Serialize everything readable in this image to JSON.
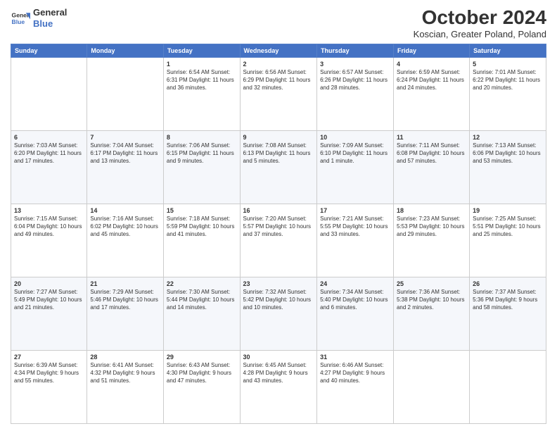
{
  "logo": {
    "line1": "General",
    "line2": "Blue"
  },
  "title": "October 2024",
  "subtitle": "Koscian, Greater Poland, Poland",
  "days_of_week": [
    "Sunday",
    "Monday",
    "Tuesday",
    "Wednesday",
    "Thursday",
    "Friday",
    "Saturday"
  ],
  "weeks": [
    [
      {
        "day": "",
        "info": ""
      },
      {
        "day": "",
        "info": ""
      },
      {
        "day": "1",
        "info": "Sunrise: 6:54 AM\nSunset: 6:31 PM\nDaylight: 11 hours\nand 36 minutes."
      },
      {
        "day": "2",
        "info": "Sunrise: 6:56 AM\nSunset: 6:29 PM\nDaylight: 11 hours\nand 32 minutes."
      },
      {
        "day": "3",
        "info": "Sunrise: 6:57 AM\nSunset: 6:26 PM\nDaylight: 11 hours\nand 28 minutes."
      },
      {
        "day": "4",
        "info": "Sunrise: 6:59 AM\nSunset: 6:24 PM\nDaylight: 11 hours\nand 24 minutes."
      },
      {
        "day": "5",
        "info": "Sunrise: 7:01 AM\nSunset: 6:22 PM\nDaylight: 11 hours\nand 20 minutes."
      }
    ],
    [
      {
        "day": "6",
        "info": "Sunrise: 7:03 AM\nSunset: 6:20 PM\nDaylight: 11 hours\nand 17 minutes."
      },
      {
        "day": "7",
        "info": "Sunrise: 7:04 AM\nSunset: 6:17 PM\nDaylight: 11 hours\nand 13 minutes."
      },
      {
        "day": "8",
        "info": "Sunrise: 7:06 AM\nSunset: 6:15 PM\nDaylight: 11 hours\nand 9 minutes."
      },
      {
        "day": "9",
        "info": "Sunrise: 7:08 AM\nSunset: 6:13 PM\nDaylight: 11 hours\nand 5 minutes."
      },
      {
        "day": "10",
        "info": "Sunrise: 7:09 AM\nSunset: 6:10 PM\nDaylight: 11 hours\nand 1 minute."
      },
      {
        "day": "11",
        "info": "Sunrise: 7:11 AM\nSunset: 6:08 PM\nDaylight: 10 hours\nand 57 minutes."
      },
      {
        "day": "12",
        "info": "Sunrise: 7:13 AM\nSunset: 6:06 PM\nDaylight: 10 hours\nand 53 minutes."
      }
    ],
    [
      {
        "day": "13",
        "info": "Sunrise: 7:15 AM\nSunset: 6:04 PM\nDaylight: 10 hours\nand 49 minutes."
      },
      {
        "day": "14",
        "info": "Sunrise: 7:16 AM\nSunset: 6:02 PM\nDaylight: 10 hours\nand 45 minutes."
      },
      {
        "day": "15",
        "info": "Sunrise: 7:18 AM\nSunset: 5:59 PM\nDaylight: 10 hours\nand 41 minutes."
      },
      {
        "day": "16",
        "info": "Sunrise: 7:20 AM\nSunset: 5:57 PM\nDaylight: 10 hours\nand 37 minutes."
      },
      {
        "day": "17",
        "info": "Sunrise: 7:21 AM\nSunset: 5:55 PM\nDaylight: 10 hours\nand 33 minutes."
      },
      {
        "day": "18",
        "info": "Sunrise: 7:23 AM\nSunset: 5:53 PM\nDaylight: 10 hours\nand 29 minutes."
      },
      {
        "day": "19",
        "info": "Sunrise: 7:25 AM\nSunset: 5:51 PM\nDaylight: 10 hours\nand 25 minutes."
      }
    ],
    [
      {
        "day": "20",
        "info": "Sunrise: 7:27 AM\nSunset: 5:49 PM\nDaylight: 10 hours\nand 21 minutes."
      },
      {
        "day": "21",
        "info": "Sunrise: 7:29 AM\nSunset: 5:46 PM\nDaylight: 10 hours\nand 17 minutes."
      },
      {
        "day": "22",
        "info": "Sunrise: 7:30 AM\nSunset: 5:44 PM\nDaylight: 10 hours\nand 14 minutes."
      },
      {
        "day": "23",
        "info": "Sunrise: 7:32 AM\nSunset: 5:42 PM\nDaylight: 10 hours\nand 10 minutes."
      },
      {
        "day": "24",
        "info": "Sunrise: 7:34 AM\nSunset: 5:40 PM\nDaylight: 10 hours\nand 6 minutes."
      },
      {
        "day": "25",
        "info": "Sunrise: 7:36 AM\nSunset: 5:38 PM\nDaylight: 10 hours\nand 2 minutes."
      },
      {
        "day": "26",
        "info": "Sunrise: 7:37 AM\nSunset: 5:36 PM\nDaylight: 9 hours\nand 58 minutes."
      }
    ],
    [
      {
        "day": "27",
        "info": "Sunrise: 6:39 AM\nSunset: 4:34 PM\nDaylight: 9 hours\nand 55 minutes."
      },
      {
        "day": "28",
        "info": "Sunrise: 6:41 AM\nSunset: 4:32 PM\nDaylight: 9 hours\nand 51 minutes."
      },
      {
        "day": "29",
        "info": "Sunrise: 6:43 AM\nSunset: 4:30 PM\nDaylight: 9 hours\nand 47 minutes."
      },
      {
        "day": "30",
        "info": "Sunrise: 6:45 AM\nSunset: 4:28 PM\nDaylight: 9 hours\nand 43 minutes."
      },
      {
        "day": "31",
        "info": "Sunrise: 6:46 AM\nSunset: 4:27 PM\nDaylight: 9 hours\nand 40 minutes."
      },
      {
        "day": "",
        "info": ""
      },
      {
        "day": "",
        "info": ""
      }
    ]
  ]
}
